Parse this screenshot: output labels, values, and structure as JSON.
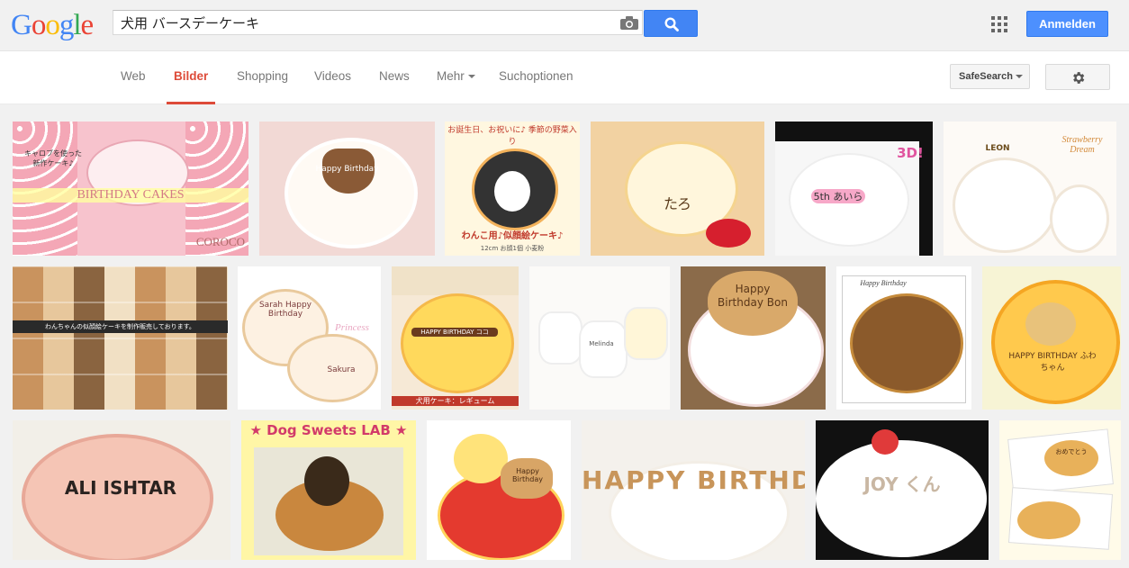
{
  "header": {
    "logo_letters": [
      "G",
      "o",
      "o",
      "g",
      "l",
      "e"
    ],
    "logo_colors": [
      "#4285f4",
      "#ea4335",
      "#fbbc05",
      "#4285f4",
      "#34a853",
      "#ea4335"
    ],
    "search_value": "犬用 バースデーケーキ",
    "signin_label": "Anmelden",
    "camera_icon": "camera-icon",
    "search_icon": "search-icon",
    "apps_icon": "apps-grid-icon"
  },
  "nav": {
    "tabs": [
      {
        "label": "Web",
        "active": false
      },
      {
        "label": "Bilder",
        "active": true
      },
      {
        "label": "Shopping",
        "active": false
      },
      {
        "label": "Videos",
        "active": false
      },
      {
        "label": "News",
        "active": false
      },
      {
        "label": "Mehr",
        "active": false
      },
      {
        "label": "Suchoptionen",
        "active": false
      }
    ],
    "safesearch_label": "SafeSearch",
    "settings_icon": "gear-icon",
    "active_color": "#dd4b39"
  },
  "results": {
    "thumbnails": [
      {
        "caption": "キャロブを使った 新作ケーキ♪",
        "caption2": "BIRTHDAY CAKES",
        "caption3": "COROCO"
      },
      {
        "caption": "Happy Birthday"
      },
      {
        "caption": "お誕生日、お祝いに♪ 季節の野菜入り",
        "caption2": "わんこ用♪似顔絵ケーキ♪",
        "caption3": "12cm お顔1個 小麦粉"
      },
      {
        "caption": "たろ"
      },
      {
        "caption": "3D!",
        "caption2": "5th あいら"
      },
      {
        "caption": "LEON",
        "caption2": "Strawberry Dream"
      },
      {
        "caption": "わんちゃんの似顔絵ケーキを制作販売しております。"
      },
      {
        "caption": "Sarah Happy Birthday",
        "caption2": "Princess",
        "caption3": "Sakura"
      },
      {
        "caption": "HAPPY BIRTHDAY ココ",
        "caption2": "犬用ケーキ：レギューム"
      },
      {
        "caption": "Melinda"
      },
      {
        "caption": "Happy Birthday Bon"
      },
      {
        "caption": "Happy Birthday"
      },
      {
        "caption": "HAPPY BIRTHDAY ふわちゃん"
      },
      {
        "caption": "ALI ISHTAR"
      },
      {
        "caption": "★ Dog Sweets LAB ★"
      },
      {
        "caption": "Happy Birthday"
      },
      {
        "caption": "HAPPY BIRTHDAY"
      },
      {
        "caption": "JOY くん"
      },
      {
        "caption": "おめでとう"
      }
    ]
  }
}
